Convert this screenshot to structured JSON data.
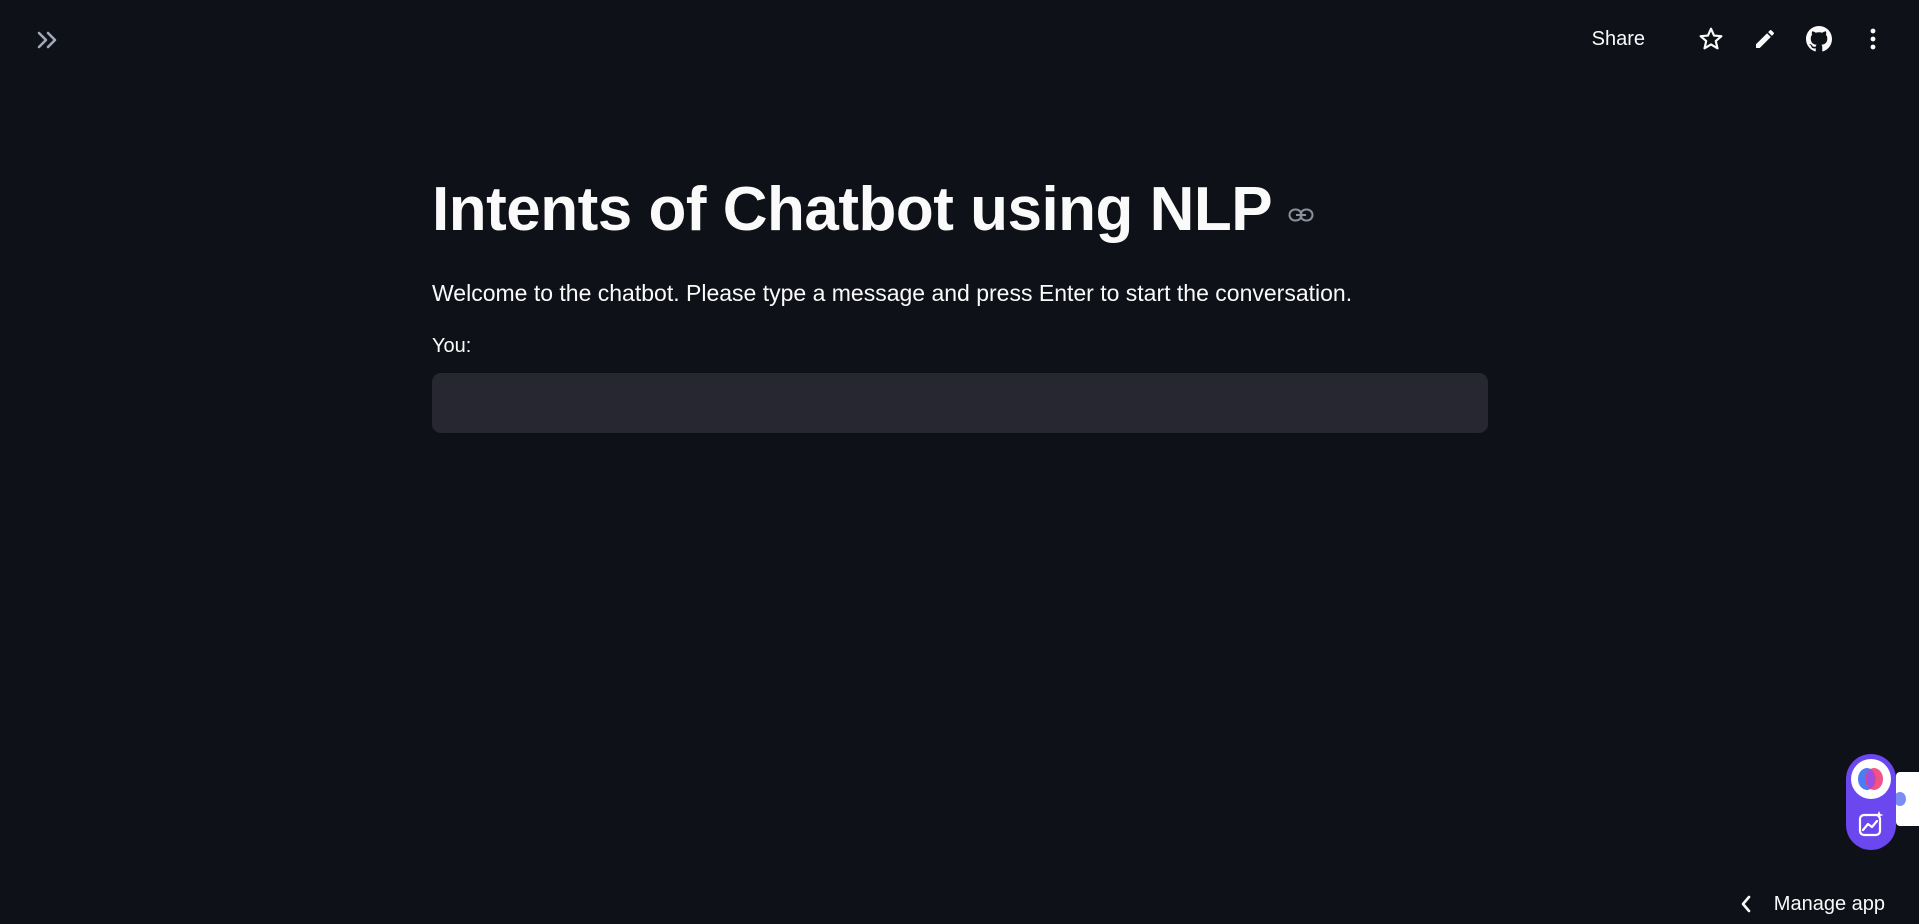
{
  "header": {
    "sidebar_toggle_icon": "double-chevron-right-icon",
    "toolbar": {
      "share_label": "Share",
      "icons": [
        "star-icon",
        "pencil-icon",
        "github-icon",
        "kebab-menu-icon"
      ]
    }
  },
  "main": {
    "title": "Intents of Chatbot using NLP",
    "title_anchor_icon": "link-icon",
    "welcome_text": "Welcome to the chatbot. Please type a message and press Enter to start the conversation.",
    "input": {
      "label": "You:",
      "value": ""
    }
  },
  "floating_widget": {
    "icons": [
      "assistant-logo-icon",
      "chart-sparkle-icon"
    ]
  },
  "footer": {
    "manage_app_label": "Manage app",
    "manage_app_icon": "chevron-left-icon"
  },
  "colors": {
    "background": "#0e1117",
    "text": "#fafafa",
    "input_background": "#262730",
    "widget_accent": "#6b47f0"
  }
}
